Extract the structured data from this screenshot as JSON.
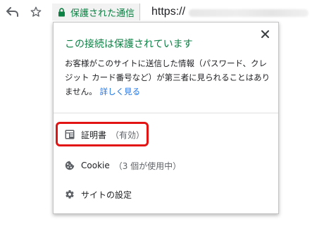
{
  "browser": {
    "security_label": "保護された通信",
    "url_scheme": "https://"
  },
  "popup": {
    "title": "この接続は保護されています",
    "description": "お客様がこのサイトに送信した情報（パスワード、クレジット カード番号など）が第三者に見られることはありません。",
    "learn_more": "詳しく見る",
    "close_icon": "close-icon",
    "items": [
      {
        "icon": "certificate-icon",
        "label": "証明書",
        "detail": "（有効）"
      },
      {
        "icon": "cookie-icon",
        "label": "Cookie",
        "detail": "（3 個が使用中）"
      },
      {
        "icon": "gear-icon",
        "label": "サイトの設定",
        "detail": ""
      }
    ]
  },
  "colors": {
    "secure_green": "#0b8043",
    "link_blue": "#1a73e8",
    "highlight_red": "#e21414"
  }
}
